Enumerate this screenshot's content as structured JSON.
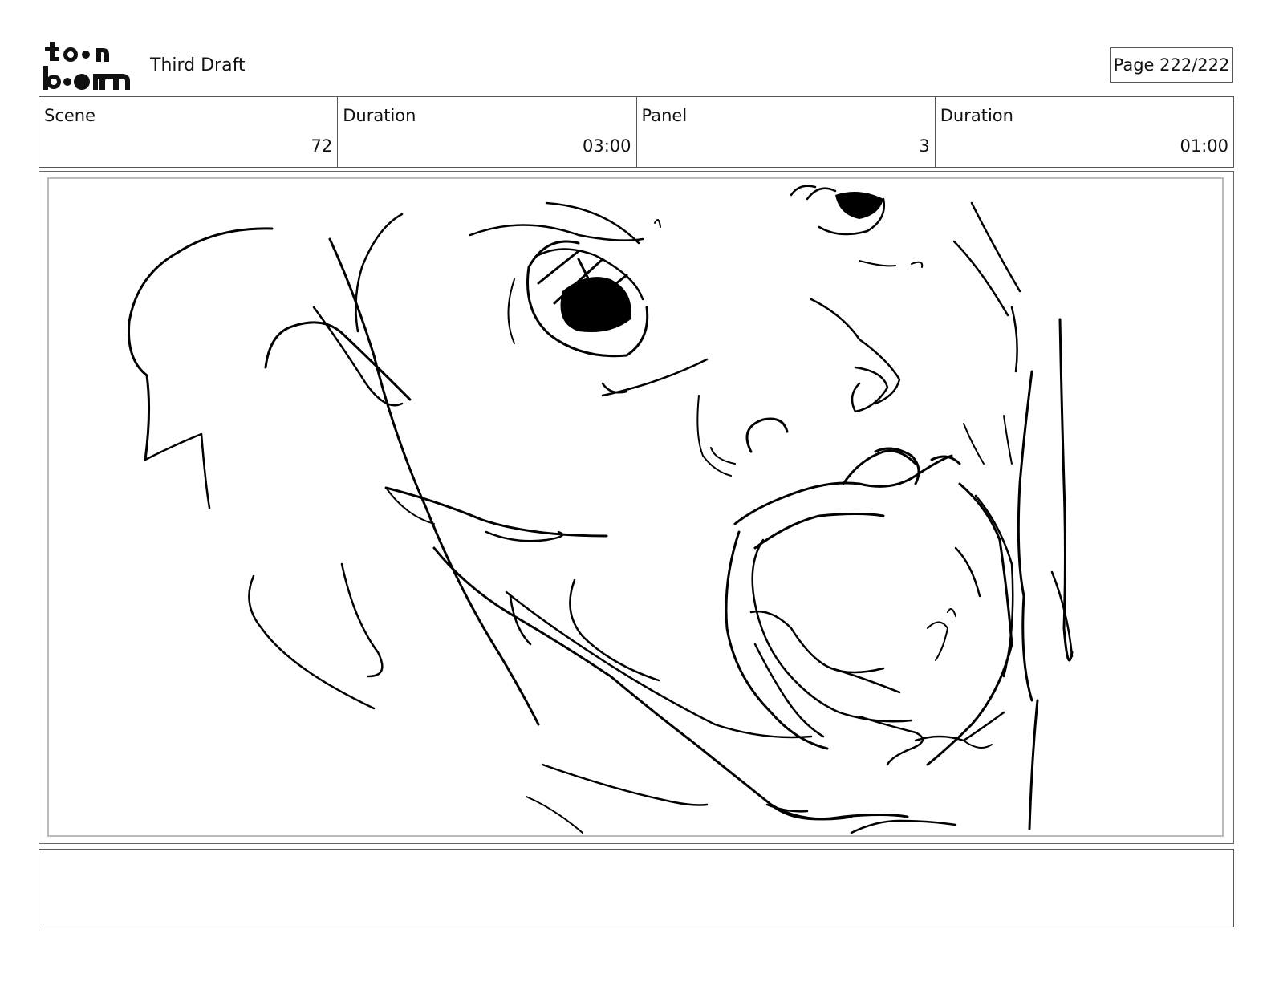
{
  "header": {
    "logo_alt": "toon boom",
    "draft_title": "Third Draft",
    "page_label": "Page 222/222"
  },
  "info": {
    "scene_label": "Scene",
    "scene_value": "72",
    "scene_duration_label": "Duration",
    "scene_duration_value": "03:00",
    "panel_label": "Panel",
    "panel_value": "3",
    "panel_duration_label": "Duration",
    "panel_duration_value": "01:00"
  },
  "panel": {
    "sketch_subject": "rough sketch of a screaming face, close-up"
  },
  "notes": {
    "text": ""
  }
}
